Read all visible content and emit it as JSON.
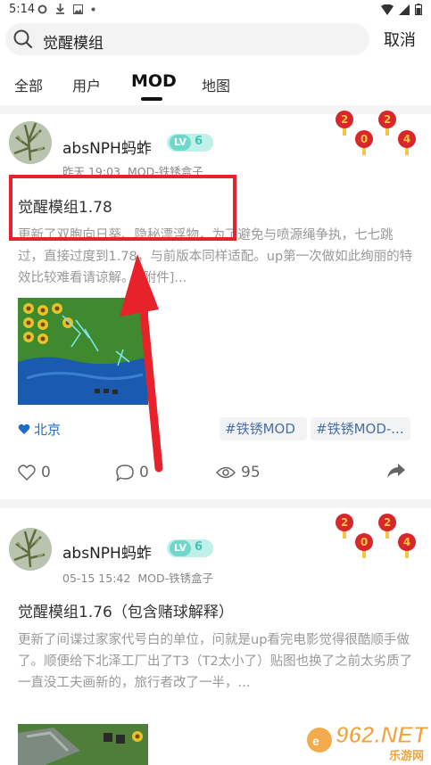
{
  "status_bar": {
    "time": "5:14"
  },
  "search": {
    "query": "觉醒模组",
    "cancel_label": "取消"
  },
  "tabs": [
    {
      "label": "全部",
      "active": false
    },
    {
      "label": "用户",
      "active": false
    },
    {
      "label": "MOD",
      "active": true
    },
    {
      "label": "地图",
      "active": false
    }
  ],
  "posts": [
    {
      "username": "absNPH蚂蚱",
      "level_prefix": "LV",
      "level": "6",
      "time": "昨天 19:03",
      "category": "MOD-铁锈盒子",
      "title": "觉醒模组1.78",
      "body": "更新了双胞向日葵、隐秘漂浮物，为了避免与喷源绳争执，七七跳过，直接过度到1.78，与前版本同样适配。up第一次做如此绚丽的特效比较难看请谅解。 [附件]...",
      "location": "北京",
      "tags": [
        "#铁锈MOD",
        "#铁锈MOD-..."
      ],
      "likes": "0",
      "comments": "0",
      "views": "95"
    },
    {
      "username": "absNPH蚂蚱",
      "level_prefix": "LV",
      "level": "6",
      "time": "05-15 15:42",
      "category": "MOD-铁锈盒子",
      "title": "觉醒模组1.76（包含赌球解释）",
      "body": "更新了间谍过家家代号白的单位，问就是up看完电影觉得很酷顺手做了。顺便给下北泽工厂出了T3（T2太小了）贴图也换了之前太劣质了一直没工夫画新的，旅行者改了一半，..."
    }
  ],
  "deco_digits": [
    "2",
    "0",
    "2",
    "4"
  ],
  "watermark": {
    "text": "962.NET",
    "sub": "乐游网"
  },
  "colors": {
    "annotation_red": "#e8222a",
    "link_blue": "#1e6ec8",
    "level_teal": "#6fd8cb"
  }
}
